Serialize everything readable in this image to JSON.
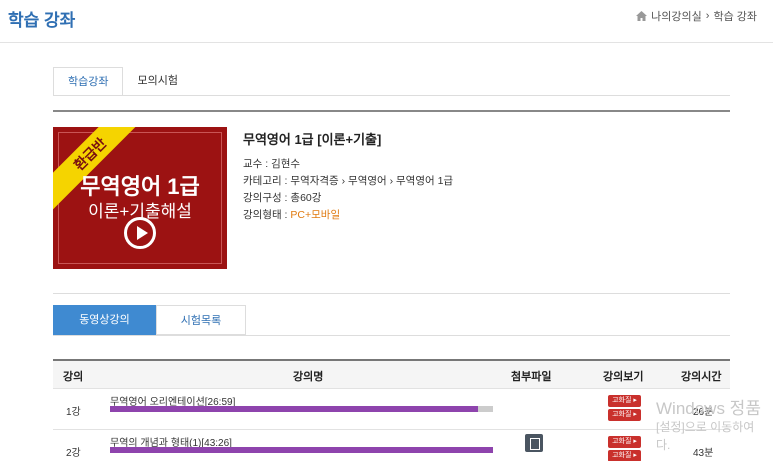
{
  "header": {
    "title": "학습 강좌",
    "breadcrumb": [
      "나의강의실",
      "학습 강좌"
    ],
    "breadcrumb_sep": "›"
  },
  "top_tabs": [
    "학습강좌",
    "모의시험"
  ],
  "thumbnail": {
    "ribbon": "환급반",
    "line1": "무역영어 1급",
    "line2": "이론+기출해설",
    "play_icon": "play-icon"
  },
  "course": {
    "title": "무역영어 1급 [이론+기출]",
    "professor_label": "교수 :",
    "professor": "김현수",
    "category_label": "카테고리 :",
    "category": "무역자격증 › 무역영어 › 무역영어 1급",
    "composition_label": "강의구성 :",
    "composition": "총60강",
    "type_label": "강의형태 :",
    "type": "PC+모바일"
  },
  "sub_tabs": [
    "동영상강의",
    "시험목록"
  ],
  "table": {
    "headers": [
      "강의",
      "강의명",
      "첨부파일",
      "강의보기",
      "강의시간"
    ],
    "rows": [
      {
        "no": "1강",
        "title": "무역영어 오리엔테이션[26:59]",
        "progress": 0.96,
        "has_file": false,
        "btn1": "고화질 ▸",
        "btn2": "고화질 ▸",
        "time": "26분"
      },
      {
        "no": "2강",
        "title": "무역의 개념과 형태(1)[43:26]",
        "progress": 1.0,
        "has_file": true,
        "btn1": "고화질 ▸",
        "btn2": "고화질 ▸",
        "time": "43분"
      }
    ]
  },
  "watermark": {
    "line1": "Windows 정품",
    "line2": "[설정]으로 이동하여",
    "line3": "다."
  }
}
